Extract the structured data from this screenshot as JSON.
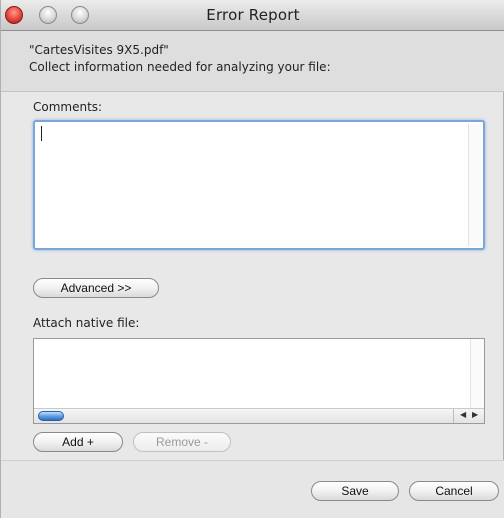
{
  "window": {
    "title": "Error Report"
  },
  "header": {
    "filename": "\"CartesVisites 9X5.pdf\"",
    "description": "Collect information needed for analyzing your file:"
  },
  "comments": {
    "label": "Comments:",
    "value": ""
  },
  "buttons": {
    "advanced": "Advanced >>",
    "add": "Add +",
    "remove": "Remove -",
    "save": "Save",
    "cancel": "Cancel"
  },
  "attach": {
    "label": "Attach native file:"
  },
  "colors": {
    "accent": "#7aa7d8",
    "close_button": "#e0443a",
    "scroll_thumb": "#5c9be0"
  },
  "icons": {
    "close": "close-icon",
    "minimize": "minimize-icon",
    "zoom": "zoom-icon",
    "scroll_left": "arrow-left-icon",
    "scroll_right": "arrow-right-icon"
  }
}
